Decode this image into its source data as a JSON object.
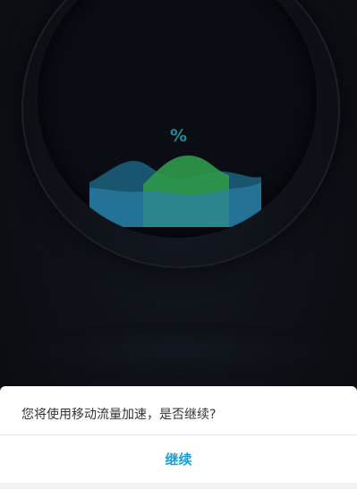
{
  "gauge": {
    "percent_symbol": "%",
    "colors": {
      "percent_text": "#1f8c9a",
      "wave_back": "#1f6e8c",
      "wave_front": "#2a7fa8",
      "wave_peak": "#2f9a4a"
    }
  },
  "dialog": {
    "message": "您将使用移动流量加速，是否继续?",
    "continue_label": "继续",
    "colors": {
      "accent": "#1a9ee0",
      "text": "#333333"
    }
  }
}
